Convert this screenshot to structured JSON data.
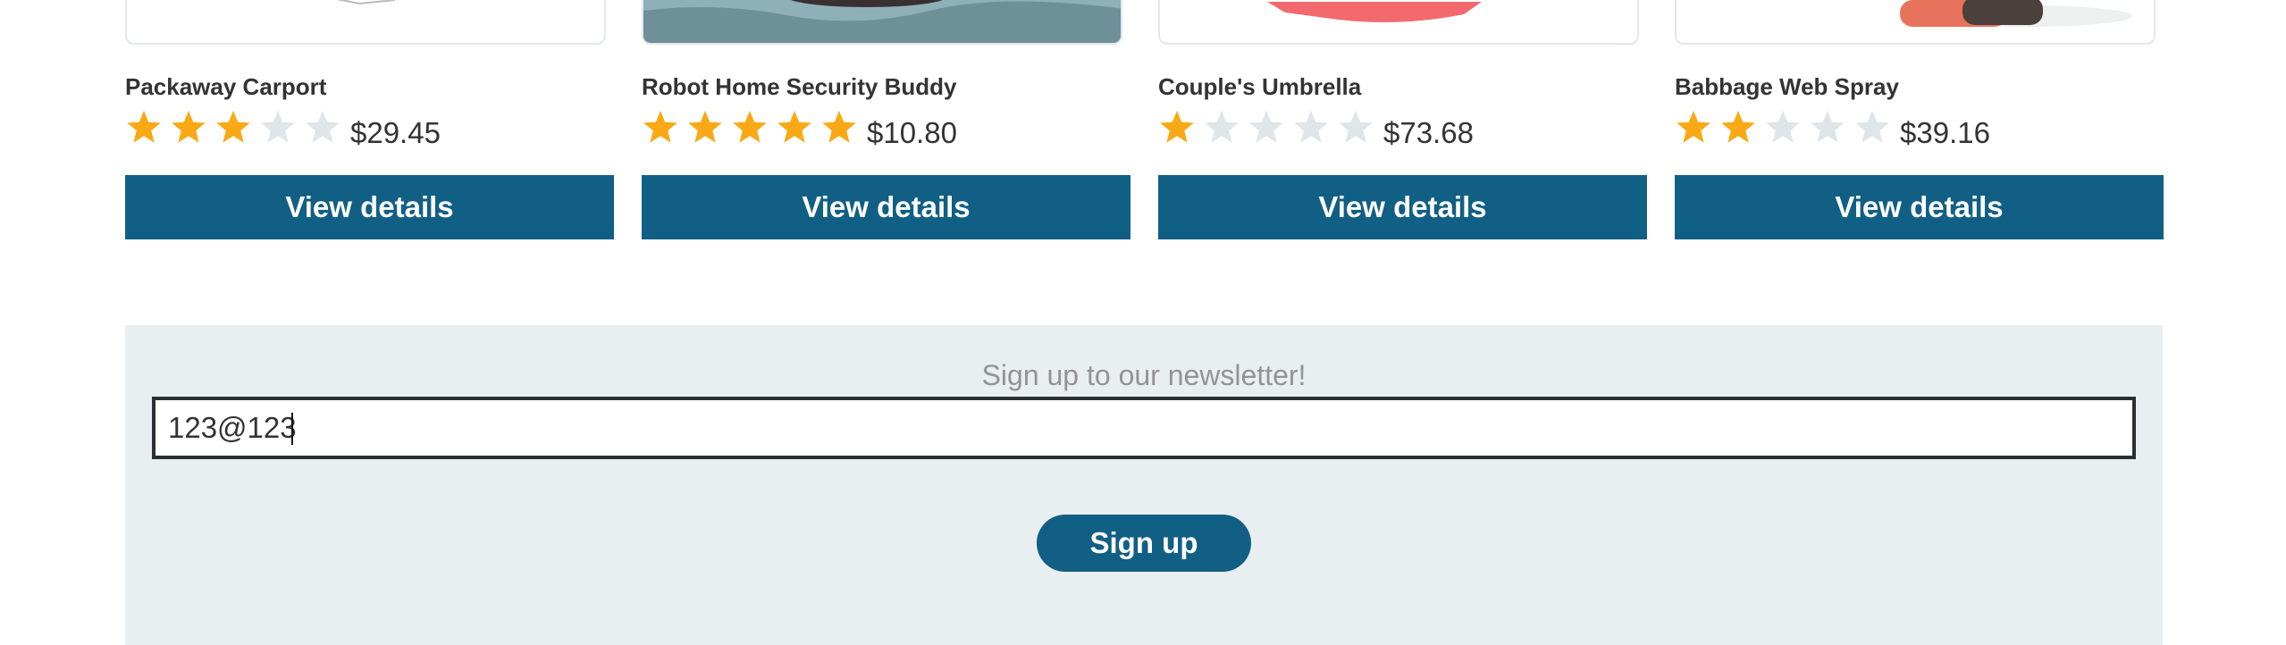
{
  "products": [
    {
      "name": "Packaway Carport",
      "price": "$29.45",
      "rating": 3,
      "max_rating": 5,
      "button_label": "View details",
      "image_icon": "carport-image-icon"
    },
    {
      "name": "Robot Home Security Buddy",
      "price": "$10.80",
      "rating": 5,
      "max_rating": 5,
      "button_label": "View details",
      "image_icon": "robot-image-icon"
    },
    {
      "name": "Couple's Umbrella",
      "price": "$73.68",
      "rating": 1,
      "max_rating": 5,
      "button_label": "View details",
      "image_icon": "umbrella-image-icon"
    },
    {
      "name": "Babbage Web Spray",
      "price": "$39.16",
      "rating": 2,
      "max_rating": 5,
      "button_label": "View details",
      "image_icon": "spray-can-image-icon"
    }
  ],
  "newsletter": {
    "title": "Sign up to our newsletter!",
    "email_value": "123@123",
    "button_label": "Sign up"
  },
  "colors": {
    "accent": "#115f85",
    "star_filled": "#f9a915",
    "star_empty": "#dfe5e8",
    "newsletter_bg": "#e9eef1"
  }
}
